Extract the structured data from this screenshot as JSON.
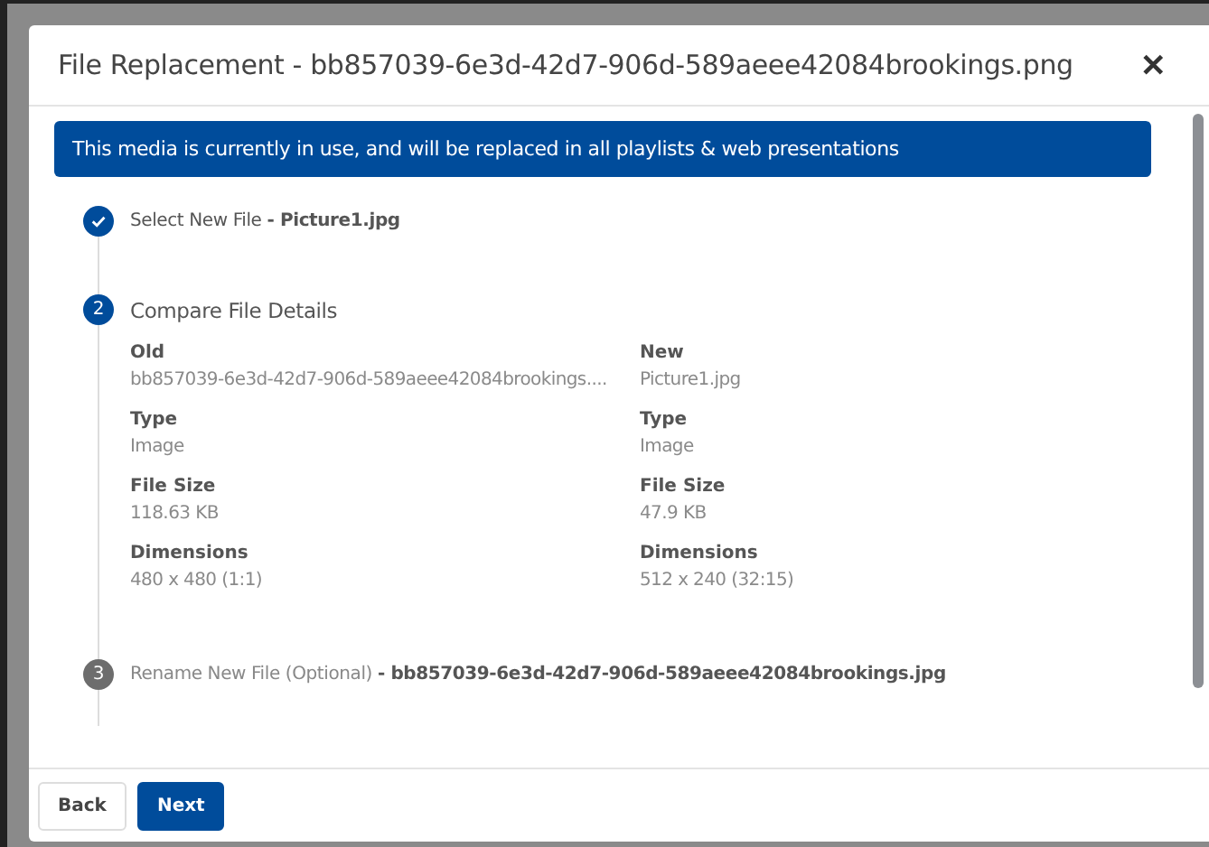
{
  "dialog": {
    "title": "File Replacement - bb857039-6e3d-42d7-906d-589aeee42084brookings.png",
    "close": "✕"
  },
  "banner": "This media is currently in use, and will be replaced in all playlists & web presentations",
  "steps": [
    {
      "kind": "done",
      "text": "Select New File **- Picture1.jpg**"
    },
    {
      "kind": "active",
      "number": "2",
      "text": "Compare File Details"
    },
    {
      "kind": "pending",
      "number": "3",
      "text": "Rename New File (Optional) **- bb857039-6e3d-42d7-906d-589aeee42084brookings.jpg**"
    }
  ],
  "comparison": [
    {
      "fields": [
        {
          "label": "Old",
          "value": "bb857039-6e3d-42d7-906d-589aeee42084brookings...."
        },
        {
          "label": "Type",
          "value": "Image"
        },
        {
          "label": "File Size",
          "value": "118.63 KB"
        },
        {
          "label": "Dimensions",
          "value": "480 x 480 (1:1)"
        }
      ]
    },
    {
      "fields": [
        {
          "label": "New",
          "value": "Picture1.jpg"
        },
        {
          "label": "Type",
          "value": "Image"
        },
        {
          "label": "File Size",
          "value": "47.9 KB"
        },
        {
          "label": "Dimensions",
          "value": "512 x 240 (32:15)"
        }
      ]
    }
  ],
  "buttons": [
    {
      "label": "Back",
      "kind": "secondary"
    },
    {
      "label": "Next",
      "kind": "primary"
    }
  ]
}
